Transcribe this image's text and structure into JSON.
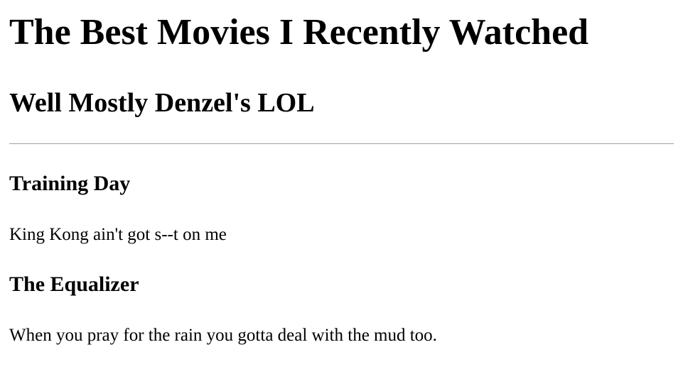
{
  "page": {
    "title": "The Best Movies I Recently Watched",
    "subtitle": "Well Mostly Denzel's LOL"
  },
  "movies": [
    {
      "title": "Training Day",
      "quote": "King Kong ain't got s--t on me"
    },
    {
      "title": "The Equalizer",
      "quote": "When you pray for the rain you gotta deal with the mud too."
    }
  ]
}
